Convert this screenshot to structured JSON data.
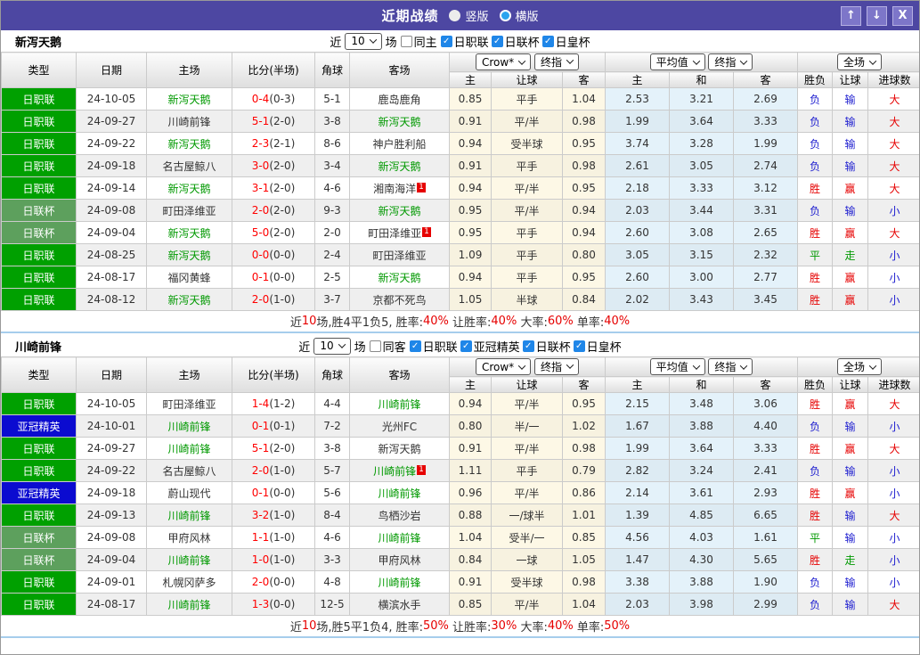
{
  "titlebar": {
    "title": "近期战绩",
    "radios": [
      {
        "label": "竖版",
        "selected": false
      },
      {
        "label": "横版",
        "selected": true
      }
    ],
    "buttons": [
      {
        "name": "move-up",
        "glyph": "↑"
      },
      {
        "name": "move-down",
        "glyph": "↓"
      },
      {
        "name": "close",
        "glyph": "X"
      }
    ]
  },
  "header_labels": {
    "type": "类型",
    "date": "日期",
    "home": "主场",
    "score_half": "比分(半场)",
    "corner": "角球",
    "away": "客场",
    "odds_selects": [
      "Crow*",
      "终指"
    ],
    "odds_cols": [
      "主",
      "让球",
      "客"
    ],
    "avg_selects": [
      "平均值",
      "终指"
    ],
    "avg_cols": [
      "主",
      "和",
      "客"
    ],
    "result_select": "全场",
    "result_cols": [
      "胜负",
      "让球",
      "进球数"
    ]
  },
  "colors": {
    "titlebar_bg": "#4d47a2",
    "checkbox_accent": "#1f86e8",
    "focus_team": "#009900",
    "score_red": "#ff0000",
    "summary_red": "#e60000"
  },
  "league_colors": {
    "日职联": "#00a000",
    "日联杯": "#5da05d",
    "亚冠精英": "#0b0bd0",
    "日皇杯": "#5da05d"
  },
  "result_colors": {
    "胜": "#e60000",
    "赢": "#e60000",
    "大": "#e60000",
    "负": "#2020d0",
    "输": "#2020d0",
    "小": "#2020d0",
    "平": "#009900",
    "走": "#009900"
  },
  "sections": [
    {
      "team": "新泻天鹅",
      "filter": {
        "near_label": "近",
        "games": "10",
        "suffix": "场",
        "same_label": "同主",
        "same_checked": false,
        "leagues": [
          "日职联",
          "日联杯",
          "日皇杯"
        ]
      },
      "rows": [
        {
          "league": "日职联",
          "date": "24-10-05",
          "home": "新泻天鹅",
          "home_focus": true,
          "home_badge": "",
          "ft": "0-4",
          "ht": "(0-3)",
          "corner": "5-1",
          "away": "鹿岛鹿角",
          "away_focus": false,
          "away_badge": "",
          "odds": [
            "0.85",
            "平手",
            "1.04"
          ],
          "avg": [
            "2.53",
            "3.21",
            "2.69"
          ],
          "results": [
            "负",
            "输",
            "大"
          ]
        },
        {
          "league": "日职联",
          "date": "24-09-27",
          "home": "川崎前锋",
          "home_focus": false,
          "home_badge": "",
          "ft": "5-1",
          "ht": "(2-0)",
          "corner": "3-8",
          "away": "新泻天鹅",
          "away_focus": true,
          "away_badge": "",
          "odds": [
            "0.91",
            "平/半",
            "0.98"
          ],
          "avg": [
            "1.99",
            "3.64",
            "3.33"
          ],
          "results": [
            "负",
            "输",
            "大"
          ]
        },
        {
          "league": "日职联",
          "date": "24-09-22",
          "home": "新泻天鹅",
          "home_focus": true,
          "home_badge": "",
          "ft": "2-3",
          "ht": "(2-1)",
          "corner": "8-6",
          "away": "神户胜利船",
          "away_focus": false,
          "away_badge": "",
          "odds": [
            "0.94",
            "受半球",
            "0.95"
          ],
          "avg": [
            "3.74",
            "3.28",
            "1.99"
          ],
          "results": [
            "负",
            "输",
            "大"
          ]
        },
        {
          "league": "日职联",
          "date": "24-09-18",
          "home": "名古屋鲸八",
          "home_focus": false,
          "home_badge": "",
          "ft": "3-0",
          "ht": "(2-0)",
          "corner": "3-4",
          "away": "新泻天鹅",
          "away_focus": true,
          "away_badge": "",
          "odds": [
            "0.91",
            "平手",
            "0.98"
          ],
          "avg": [
            "2.61",
            "3.05",
            "2.74"
          ],
          "results": [
            "负",
            "输",
            "大"
          ]
        },
        {
          "league": "日职联",
          "date": "24-09-14",
          "home": "新泻天鹅",
          "home_focus": true,
          "home_badge": "",
          "ft": "3-1",
          "ht": "(2-0)",
          "corner": "4-6",
          "away": "湘南海洋",
          "away_focus": false,
          "away_badge": "1",
          "odds": [
            "0.94",
            "平/半",
            "0.95"
          ],
          "avg": [
            "2.18",
            "3.33",
            "3.12"
          ],
          "results": [
            "胜",
            "赢",
            "大"
          ]
        },
        {
          "league": "日联杯",
          "date": "24-09-08",
          "home": "町田泽维亚",
          "home_focus": false,
          "home_badge": "",
          "ft": "2-0",
          "ht": "(2-0)",
          "corner": "9-3",
          "away": "新泻天鹅",
          "away_focus": true,
          "away_badge": "",
          "odds": [
            "0.95",
            "平/半",
            "0.94"
          ],
          "avg": [
            "2.03",
            "3.44",
            "3.31"
          ],
          "results": [
            "负",
            "输",
            "小"
          ]
        },
        {
          "league": "日联杯",
          "date": "24-09-04",
          "home": "新泻天鹅",
          "home_focus": true,
          "home_badge": "",
          "ft": "5-0",
          "ht": "(2-0)",
          "corner": "2-0",
          "away": "町田泽维亚",
          "away_focus": false,
          "away_badge": "1",
          "odds": [
            "0.95",
            "平手",
            "0.94"
          ],
          "avg": [
            "2.60",
            "3.08",
            "2.65"
          ],
          "results": [
            "胜",
            "赢",
            "大"
          ]
        },
        {
          "league": "日职联",
          "date": "24-08-25",
          "home": "新泻天鹅",
          "home_focus": true,
          "home_badge": "",
          "ft": "0-0",
          "ht": "(0-0)",
          "corner": "2-4",
          "away": "町田泽维亚",
          "away_focus": false,
          "away_badge": "",
          "odds": [
            "1.09",
            "平手",
            "0.80"
          ],
          "avg": [
            "3.05",
            "3.15",
            "2.32"
          ],
          "results": [
            "平",
            "走",
            "小"
          ]
        },
        {
          "league": "日职联",
          "date": "24-08-17",
          "home": "福冈黄蜂",
          "home_focus": false,
          "home_badge": "",
          "ft": "0-1",
          "ht": "(0-0)",
          "corner": "2-5",
          "away": "新泻天鹅",
          "away_focus": true,
          "away_badge": "",
          "odds": [
            "0.94",
            "平手",
            "0.95"
          ],
          "avg": [
            "2.60",
            "3.00",
            "2.77"
          ],
          "results": [
            "胜",
            "赢",
            "小"
          ]
        },
        {
          "league": "日职联",
          "date": "24-08-12",
          "home": "新泻天鹅",
          "home_focus": true,
          "home_badge": "",
          "ft": "2-0",
          "ht": "(1-0)",
          "corner": "3-7",
          "away": "京都不死鸟",
          "away_focus": false,
          "away_badge": "",
          "odds": [
            "1.05",
            "半球",
            "0.84"
          ],
          "avg": [
            "2.02",
            "3.43",
            "3.45"
          ],
          "results": [
            "胜",
            "赢",
            "小"
          ]
        }
      ],
      "summary_parts": [
        {
          "text": "近"
        },
        {
          "text": "10",
          "red": true
        },
        {
          "text": "场,胜4平1负5, 胜率:"
        },
        {
          "text": "40%",
          "red": true
        },
        {
          "text": " 让胜率:"
        },
        {
          "text": "40%",
          "red": true
        },
        {
          "text": " 大率:"
        },
        {
          "text": "60%",
          "red": true
        },
        {
          "text": " 单率:"
        },
        {
          "text": "40%",
          "red": true
        }
      ]
    },
    {
      "team": "川崎前锋",
      "filter": {
        "near_label": "近",
        "games": "10",
        "suffix": "场",
        "same_label": "同客",
        "same_checked": false,
        "leagues": [
          "日职联",
          "亚冠精英",
          "日联杯",
          "日皇杯"
        ]
      },
      "rows": [
        {
          "league": "日职联",
          "date": "24-10-05",
          "home": "町田泽维亚",
          "home_focus": false,
          "home_badge": "",
          "ft": "1-4",
          "ht": "(1-2)",
          "corner": "4-4",
          "away": "川崎前锋",
          "away_focus": true,
          "away_badge": "",
          "odds": [
            "0.94",
            "平/半",
            "0.95"
          ],
          "avg": [
            "2.15",
            "3.48",
            "3.06"
          ],
          "results": [
            "胜",
            "赢",
            "大"
          ]
        },
        {
          "league": "亚冠精英",
          "date": "24-10-01",
          "home": "川崎前锋",
          "home_focus": true,
          "home_badge": "",
          "ft": "0-1",
          "ht": "(0-1)",
          "corner": "7-2",
          "away": "光州FC",
          "away_focus": false,
          "away_badge": "",
          "odds": [
            "0.80",
            "半/一",
            "1.02"
          ],
          "avg": [
            "1.67",
            "3.88",
            "4.40"
          ],
          "results": [
            "负",
            "输",
            "小"
          ]
        },
        {
          "league": "日职联",
          "date": "24-09-27",
          "home": "川崎前锋",
          "home_focus": true,
          "home_badge": "",
          "ft": "5-1",
          "ht": "(2-0)",
          "corner": "3-8",
          "away": "新泻天鹅",
          "away_focus": false,
          "away_badge": "",
          "odds": [
            "0.91",
            "平/半",
            "0.98"
          ],
          "avg": [
            "1.99",
            "3.64",
            "3.33"
          ],
          "results": [
            "胜",
            "赢",
            "大"
          ]
        },
        {
          "league": "日职联",
          "date": "24-09-22",
          "home": "名古屋鲸八",
          "home_focus": false,
          "home_badge": "",
          "ft": "2-0",
          "ht": "(1-0)",
          "corner": "5-7",
          "away": "川崎前锋",
          "away_focus": true,
          "away_badge": "1",
          "odds": [
            "1.11",
            "平手",
            "0.79"
          ],
          "avg": [
            "2.82",
            "3.24",
            "2.41"
          ],
          "results": [
            "负",
            "输",
            "小"
          ]
        },
        {
          "league": "亚冠精英",
          "date": "24-09-18",
          "home": "蔚山现代",
          "home_focus": false,
          "home_badge": "",
          "ft": "0-1",
          "ht": "(0-0)",
          "corner": "5-6",
          "away": "川崎前锋",
          "away_focus": true,
          "away_badge": "",
          "odds": [
            "0.96",
            "平/半",
            "0.86"
          ],
          "avg": [
            "2.14",
            "3.61",
            "2.93"
          ],
          "results": [
            "胜",
            "赢",
            "小"
          ]
        },
        {
          "league": "日职联",
          "date": "24-09-13",
          "home": "川崎前锋",
          "home_focus": true,
          "home_badge": "",
          "ft": "3-2",
          "ht": "(1-0)",
          "corner": "8-4",
          "away": "鸟栖沙岩",
          "away_focus": false,
          "away_badge": "",
          "odds": [
            "0.88",
            "一/球半",
            "1.01"
          ],
          "avg": [
            "1.39",
            "4.85",
            "6.65"
          ],
          "results": [
            "胜",
            "输",
            "大"
          ]
        },
        {
          "league": "日联杯",
          "date": "24-09-08",
          "home": "甲府风林",
          "home_focus": false,
          "home_badge": "",
          "ft": "1-1",
          "ht": "(1-0)",
          "corner": "4-6",
          "away": "川崎前锋",
          "away_focus": true,
          "away_badge": "",
          "odds": [
            "1.04",
            "受半/一",
            "0.85"
          ],
          "avg": [
            "4.56",
            "4.03",
            "1.61"
          ],
          "results": [
            "平",
            "输",
            "小"
          ]
        },
        {
          "league": "日联杯",
          "date": "24-09-04",
          "home": "川崎前锋",
          "home_focus": true,
          "home_badge": "",
          "ft": "1-0",
          "ht": "(1-0)",
          "corner": "3-3",
          "away": "甲府风林",
          "away_focus": false,
          "away_badge": "",
          "odds": [
            "0.84",
            "一球",
            "1.05"
          ],
          "avg": [
            "1.47",
            "4.30",
            "5.65"
          ],
          "results": [
            "胜",
            "走",
            "小"
          ]
        },
        {
          "league": "日职联",
          "date": "24-09-01",
          "home": "札幌冈萨多",
          "home_focus": false,
          "home_badge": "",
          "ft": "2-0",
          "ht": "(0-0)",
          "corner": "4-8",
          "away": "川崎前锋",
          "away_focus": true,
          "away_badge": "",
          "odds": [
            "0.91",
            "受半球",
            "0.98"
          ],
          "avg": [
            "3.38",
            "3.88",
            "1.90"
          ],
          "results": [
            "负",
            "输",
            "小"
          ]
        },
        {
          "league": "日职联",
          "date": "24-08-17",
          "home": "川崎前锋",
          "home_focus": true,
          "home_badge": "",
          "ft": "1-3",
          "ht": "(0-0)",
          "corner": "12-5",
          "away": "横滨水手",
          "away_focus": false,
          "away_badge": "",
          "odds": [
            "0.85",
            "平/半",
            "1.04"
          ],
          "avg": [
            "2.03",
            "3.98",
            "2.99"
          ],
          "results": [
            "负",
            "输",
            "大"
          ]
        }
      ],
      "summary_parts": [
        {
          "text": "近"
        },
        {
          "text": "10",
          "red": true
        },
        {
          "text": "场,胜5平1负4, 胜率:"
        },
        {
          "text": "50%",
          "red": true
        },
        {
          "text": " 让胜率:"
        },
        {
          "text": "30%",
          "red": true
        },
        {
          "text": " 大率:"
        },
        {
          "text": "40%",
          "red": true
        },
        {
          "text": " 单率:"
        },
        {
          "text": "50%",
          "red": true
        }
      ]
    }
  ]
}
